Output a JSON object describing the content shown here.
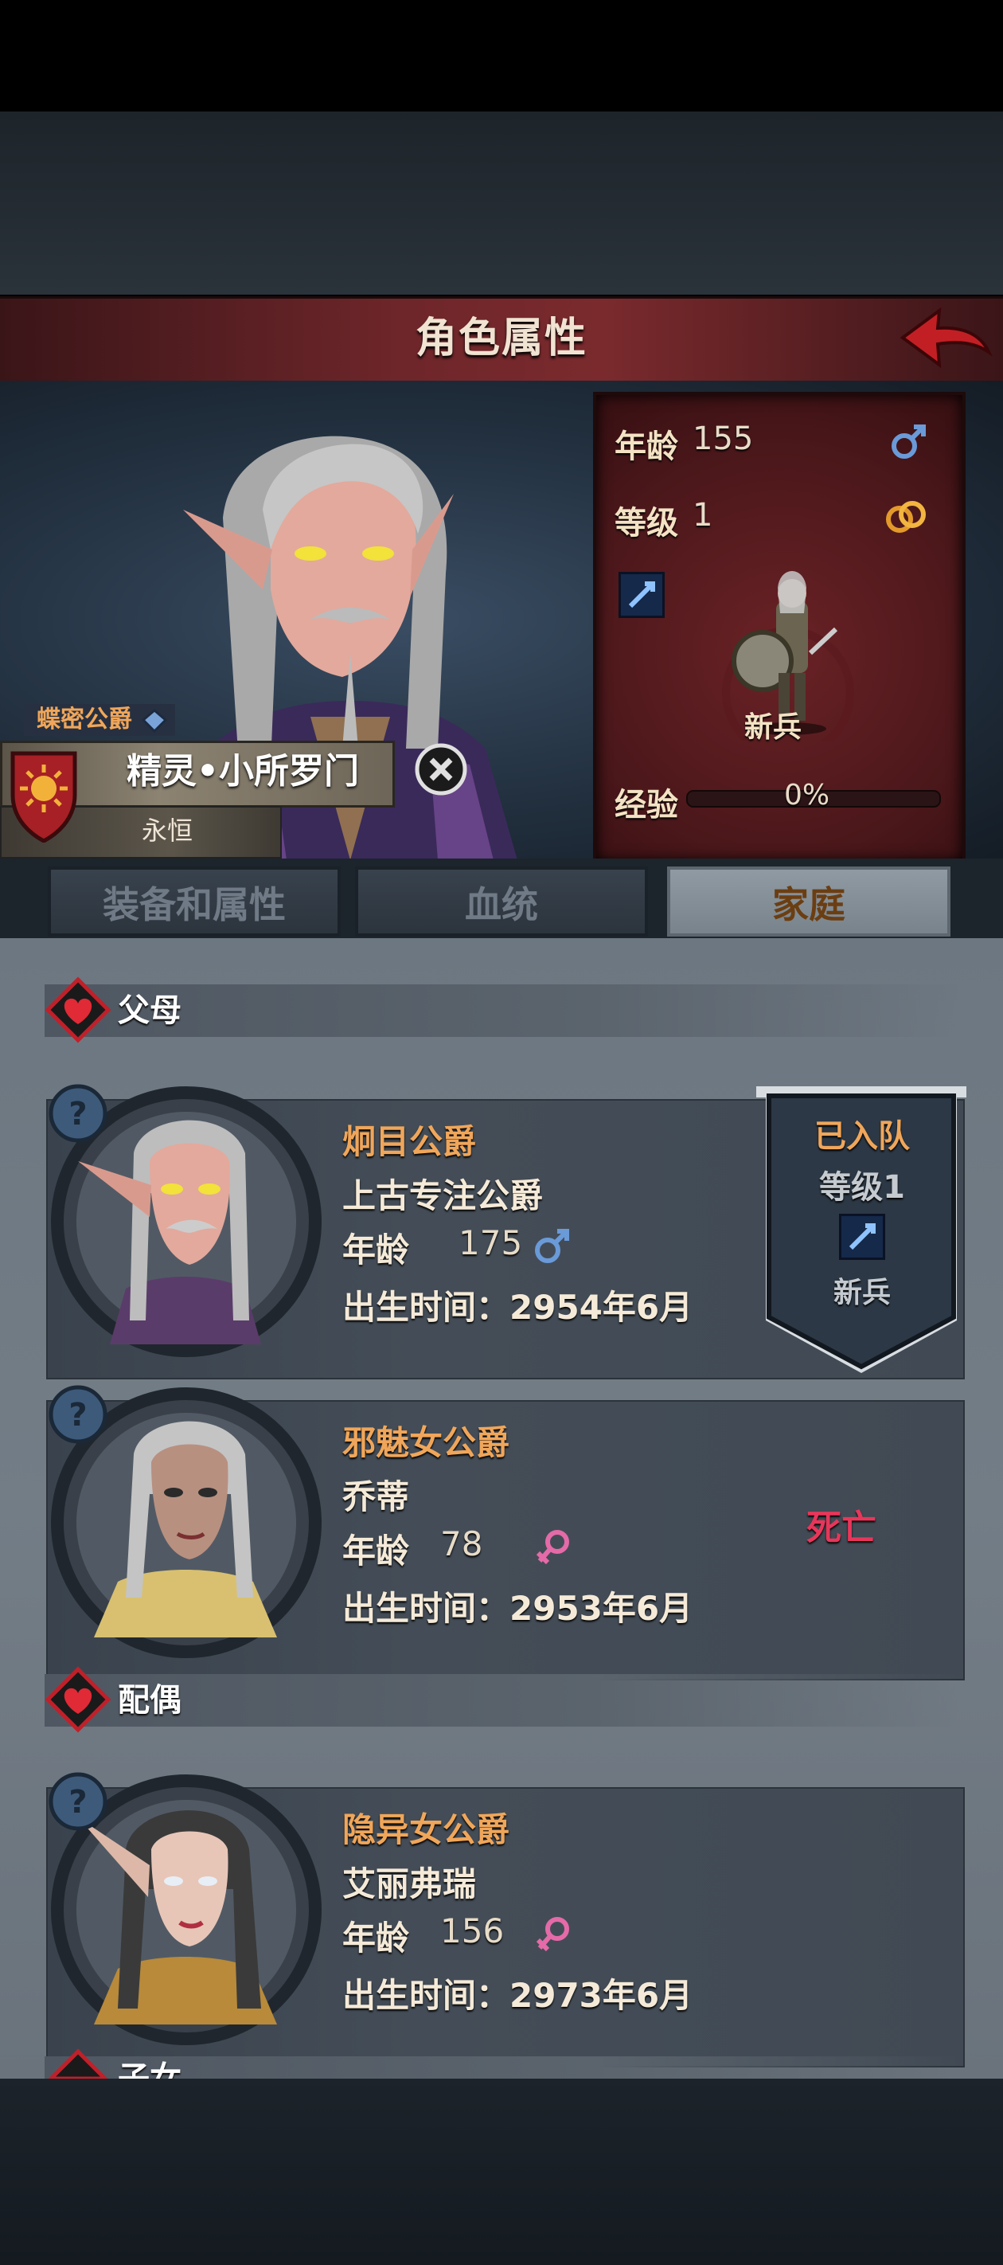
{
  "header": {
    "title": "角色属性"
  },
  "character": {
    "title": "蝶密公爵",
    "name": "精灵•小所罗门",
    "subtitle": "永恒",
    "stats": {
      "age_label": "年龄",
      "age": "155",
      "level_label": "等级",
      "level": "1",
      "exp_label": "经验",
      "exp_value": "0%",
      "exp_progress": 0,
      "class_name": "新兵"
    }
  },
  "tabs": [
    {
      "label": "装备和属性",
      "active": false
    },
    {
      "label": "血统",
      "active": false
    },
    {
      "label": "家庭",
      "active": true
    }
  ],
  "family": {
    "parents_label": "父母",
    "spouse_label": "配偶",
    "children_label": "子女",
    "members": [
      {
        "role": "炯目公爵",
        "name": "上古专注公爵",
        "age_label": "年龄",
        "age": "175",
        "gender": "male",
        "birth": "出生时间：2954年6月"
      },
      {
        "role": "邪魅女公爵",
        "name": "乔蒂",
        "age_label": "年龄",
        "age": "78",
        "gender": "female",
        "birth": "出生时间：2953年6月",
        "status": "死亡"
      },
      {
        "role": "隐异女公爵",
        "name": "艾丽弗瑞",
        "age_label": "年龄",
        "age": "156",
        "gender": "female",
        "birth": "出生时间：2973年6月"
      }
    ],
    "banner": {
      "status": "已入队",
      "level": "等级1",
      "class_name": "新兵"
    }
  },
  "colors": {
    "accent_orange": "#f0a65a",
    "dead_red": "#e8365a",
    "male_blue": "#6a9ad8",
    "female_pink": "#e56aa8"
  }
}
